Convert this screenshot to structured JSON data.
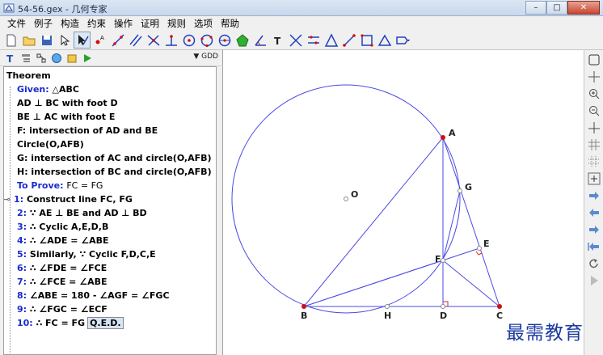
{
  "window": {
    "title": "54-56.gex - 几何专家",
    "minimize": "–",
    "maximize": "□",
    "close": "✕"
  },
  "menu": [
    "文件",
    "例子",
    "构造",
    "约束",
    "操作",
    "证明",
    "规则",
    "选项",
    "帮助"
  ],
  "toolbar": {
    "icons": [
      "new-file-icon",
      "open-folder-icon",
      "save-icon",
      "select-arrow-icon",
      "select-bold-icon",
      "point-icon",
      "line-icon",
      "parallel-icon",
      "perpendicular-icon",
      "foot-icon",
      "circle-center-icon",
      "circle-three-point-icon",
      "circle-diameter-icon",
      "polygon-icon",
      "angle-icon",
      "text-icon",
      "intersect-icon",
      "ratio-icon",
      "triangle-icon",
      "segment-icon",
      "square-icon",
      "isoceles-icon",
      "more-dropdown-icon"
    ]
  },
  "panel": {
    "mode_label": "GDD"
  },
  "tree": {
    "root": "Theorem",
    "given_label": "Given:",
    "given_value": "△ABC",
    "conditions": [
      "AD ⊥ BC with foot D",
      "BE ⊥ AC with foot E",
      "F: intersection of AD and BE",
      "Circle(O,AFB)",
      "G: intersection of AC and circle(O,AFB)",
      "H: intersection of BC and circle(O,AFB)"
    ],
    "prove_label": "To Prove:",
    "prove_value": "FC = FG",
    "steps": [
      {
        "num": "1:",
        "text": "Construct line FC, FG"
      },
      {
        "num": "2:",
        "text": "∵ AE ⊥ BE and AD ⊥ BD"
      },
      {
        "num": "3:",
        "text": "∴ Cyclic A,E,D,B"
      },
      {
        "num": "4:",
        "text": "∴ ∠ADE = ∠ABE"
      },
      {
        "num": "5:",
        "text": "Similarly, ∵ Cyclic F,D,C,E"
      },
      {
        "num": "6:",
        "text": "∴ ∠FDE = ∠FCE"
      },
      {
        "num": "7:",
        "text": "∴ ∠FCE = ∠ABE"
      },
      {
        "num": "8:",
        "text": "∠ABE = 180 - ∠AGF = ∠FGC"
      },
      {
        "num": "9:",
        "text": "∴ ∠FGC = ∠ECF"
      },
      {
        "num": "10:",
        "text": "∴ FC = FG"
      }
    ],
    "qed": "Q.E.D."
  },
  "diagram": {
    "labels": {
      "A": "A",
      "B": "B",
      "C": "C",
      "D": "D",
      "E": "E",
      "F": "F",
      "G": "G",
      "H": "H",
      "O": "O"
    },
    "colors": {
      "line": "#4a4ae6",
      "point_red": "#d01010",
      "point_gray": "#888888",
      "right_angle": "#e02020"
    }
  },
  "right_tools": [
    "layout-icon",
    "move-icon",
    "zoom-in-icon",
    "zoom-out-icon",
    "axis-icon",
    "grid-icon",
    "grid-dot-icon",
    "grid-snap-icon",
    "arrow-right-icon",
    "arrow-left-icon",
    "step-forward-icon",
    "step-back-icon",
    "redo-icon",
    "play-icon"
  ],
  "watermark": "最需教育"
}
